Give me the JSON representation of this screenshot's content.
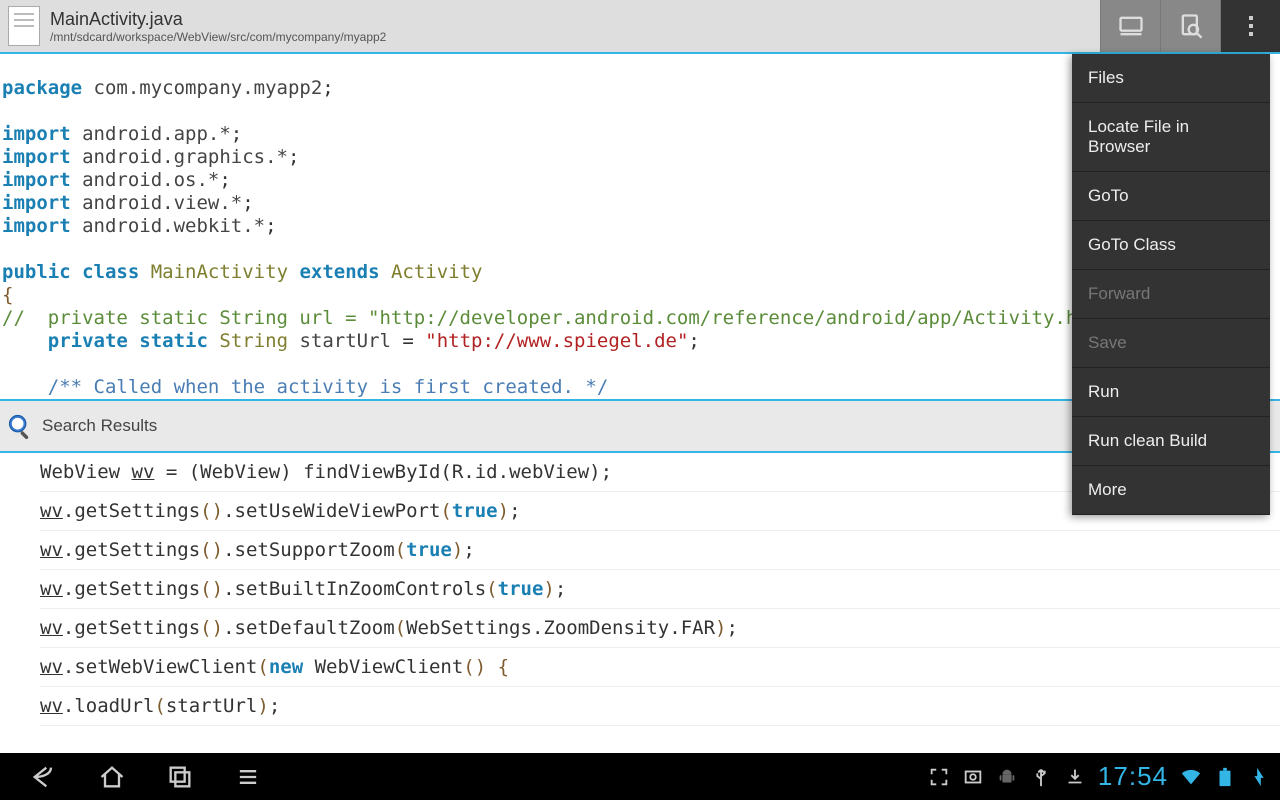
{
  "header": {
    "filename": "MainActivity.java",
    "filepath": "/mnt/sdcard/workspace/WebView/src/com/mycompany/myapp2"
  },
  "code": {
    "package_kw": "package",
    "package_name": " com.mycompany.myapp2",
    "import_kw": "import",
    "imports": [
      " android.app.*",
      " android.graphics.*",
      " android.os.*",
      " android.view.*",
      " android.webkit.*"
    ],
    "public_kw": "public",
    "class_kw": "class",
    "classname": " MainActivity ",
    "extends_kw": "extends",
    "supername": " Activity",
    "brace": "{",
    "comment_url": "//  private static String url = \"http://developer.android.com/reference/android/app/Activity.html",
    "indent": "    ",
    "private_kw": "private",
    "static_kw": "static",
    "string_type": " String ",
    "starturl_name": "startUrl ",
    "eq": "=",
    "url_value": " \"http://www.spiegel.de\"",
    "semi": ";",
    "javadoc": "    /** Called when the activity is first created. */"
  },
  "search": {
    "label": "Search Results"
  },
  "results": {
    "r1": {
      "a": "WebView ",
      "wv": "wv",
      "b": " = (WebView) findViewById(R",
      "c": "id",
      "d": "webView)"
    },
    "r2": {
      "wv": "wv",
      "a": ".getSettings",
      "b": ".setUseWideViewPort",
      "t": "true"
    },
    "r3": {
      "wv": "wv",
      "a": ".getSettings",
      "b": ".setSupportZoom",
      "t": "true"
    },
    "r4": {
      "wv": "wv",
      "a": ".getSettings",
      "b": ".setBuiltInZoomControls",
      "t": "true"
    },
    "r5": {
      "wv": "wv",
      "a": ".getSettings",
      "b": ".setDefaultZoom",
      "c": "WebSettings",
      "d": "ZoomDensity",
      "e": "FAR"
    },
    "r6": {
      "wv": "wv",
      "a": ".setWebViewClient",
      "n": "new",
      "c": " WebViewClient"
    },
    "r7": {
      "wv": "wv",
      "a": ".loadUrl",
      "b": "startUrl"
    }
  },
  "menu": {
    "files": "Files",
    "locate": "Locate File in Browser",
    "goto": "GoTo",
    "gotoclass": "GoTo Class",
    "forward": "Forward",
    "save": "Save",
    "run": "Run",
    "cleanbuild": "Run clean Build",
    "more": "More"
  },
  "status": {
    "time": "17:54"
  }
}
